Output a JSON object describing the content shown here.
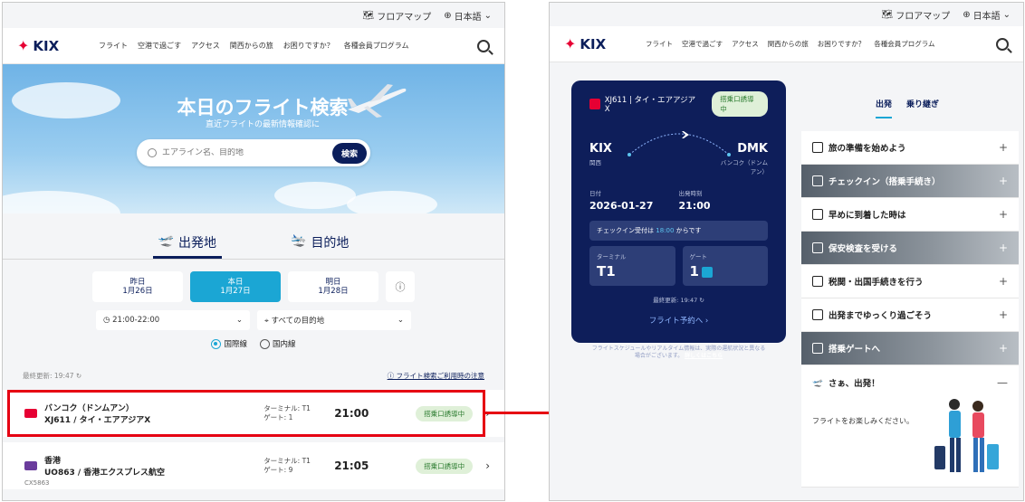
{
  "left": {
    "util": {
      "floor_map": "フロアマップ",
      "language": "日本語"
    },
    "nav": {
      "logo": "KIX",
      "menu": [
        "フライト",
        "空港で過ごす",
        "アクセス",
        "関西からの旅",
        "お困りですか？",
        "各種会員プログラム"
      ]
    },
    "hero": {
      "title": "本日のフライト検索",
      "subtitle": "直近フライトの最新情報確認に",
      "search_placeholder": "エアライン名、目的地",
      "search_button": "検索"
    },
    "tabs": [
      "出発地",
      "目的地"
    ],
    "days": [
      {
        "label": "昨日",
        "date": "1月26日"
      },
      {
        "label": "本日",
        "date": "1月27日"
      },
      {
        "label": "明日",
        "date": "1月28日"
      }
    ],
    "time_filter": "21:00-22:00",
    "dest_filter": "すべての目的地",
    "radios": [
      "国際線",
      "国内線"
    ],
    "last_updated": "最終更新: 19:47",
    "notice_link": "フライト検索ご利用時の注意",
    "flights": [
      {
        "dest": "バンコク（ドンムアン）",
        "code": "XJ611 / タイ・エアアジアX",
        "terminal": "ターミナル: T1",
        "gate": "ゲート: 1",
        "time": "21:00",
        "status": "搭乗口誘導中",
        "codeshare": ""
      },
      {
        "dest": "香港",
        "code": "UO863 / 香港エクスプレス航空",
        "terminal": "ターミナル: T1",
        "gate": "ゲート: 9",
        "time": "21:05",
        "status": "搭乗口誘導中",
        "codeshare": "CX5863"
      }
    ]
  },
  "right": {
    "util": {
      "floor_map": "フロアマップ",
      "language": "日本語"
    },
    "nav": {
      "logo": "KIX",
      "menu": [
        "フライト",
        "空港で過ごす",
        "アクセス",
        "関西からの旅",
        "お困りですか？",
        "各種会員プログラム"
      ]
    },
    "card": {
      "flight": "XJ611 | タイ・エアアジアX",
      "status": "搭乗口誘導中",
      "from_code": "KIX",
      "from_name": "関西",
      "to_code": "DMK",
      "to_name": "バンコク（ドンムアン）",
      "date_label": "日付",
      "date": "2026-01-27",
      "time_label": "出発時刻",
      "time": "21:00",
      "checkin_notice_pre": "チェックイン受付は",
      "checkin_time": "18:00",
      "checkin_notice_post": "からです",
      "terminal_label": "ターミナル",
      "terminal": "T1",
      "gate_label": "ゲート",
      "gate": "1",
      "updated": "最終更新: 19:47",
      "reserve": "フライト予約へ ›",
      "disclaimer": "フライトスケジュールやリアルタイム情報は、実際の運航状況と異なる場合がございます。",
      "disclaimer_link": "詳しくはこちら"
    },
    "tabs": [
      "出発",
      "乗り継ぎ"
    ],
    "steps": [
      {
        "label": "旅の準備を始めよう",
        "dark": false
      },
      {
        "label": "チェックイン（搭乗手続き）",
        "dark": true
      },
      {
        "label": "早めに到着した時は",
        "dark": false
      },
      {
        "label": "保安検査を受ける",
        "dark": true
      },
      {
        "label": "税関・出国手続きを行う",
        "dark": false
      },
      {
        "label": "出発までゆっくり過ごそう",
        "dark": false
      },
      {
        "label": "搭乗ゲートへ",
        "dark": true
      }
    ],
    "final": {
      "label": "さぁ、出発！",
      "text": "フライトをお楽しみください。"
    }
  },
  "colors": {
    "navy": "#0b1e5b",
    "accent": "#1ba6d4",
    "highlight": "#e60012",
    "status_bg": "#dff0d8"
  }
}
